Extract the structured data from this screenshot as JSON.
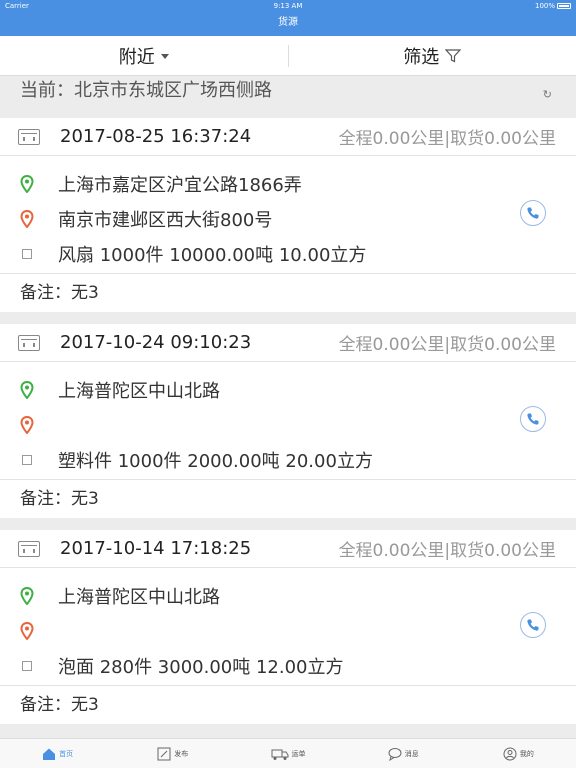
{
  "status": {
    "carrier": "Carrier",
    "time": "9:13 AM",
    "battery": "100%"
  },
  "nav": {
    "title": "货源"
  },
  "filter": {
    "nearby_label": "附近",
    "filter_label": "筛选"
  },
  "location": {
    "current": "当前：北京市东城区广场西侧路"
  },
  "cards": [
    {
      "date": "2017-08-25 16:37:24",
      "distance": "全程0.00公里|取货0.00公里",
      "from": "上海市嘉定区沪宜公路1866弄",
      "to": "南京市建邺区西大街800号",
      "goods": "风扇 1000件  10000.00吨  10.00立方",
      "note": "备注：无3"
    },
    {
      "date": "2017-10-24 09:10:23",
      "distance": "全程0.00公里|取货0.00公里",
      "from": "上海普陀区中山北路",
      "to": "",
      "goods": "塑料件 1000件  2000.00吨  20.00立方",
      "note": "备注：无3"
    },
    {
      "date": "2017-10-14 17:18:25",
      "distance": "全程0.00公里|取货0.00公里",
      "from": "上海普陀区中山北路",
      "to": "",
      "goods": "泡面 280件  3000.00吨  12.00立方",
      "note": "备注：无3"
    }
  ],
  "tabs": [
    {
      "label": "首页",
      "icon": "home-icon"
    },
    {
      "label": "发布",
      "icon": "edit-icon"
    },
    {
      "label": "运单",
      "icon": "truck-icon"
    },
    {
      "label": "消息",
      "icon": "chat-icon"
    },
    {
      "label": "我的",
      "icon": "user-icon"
    }
  ],
  "colors": {
    "accent": "#4a90e2",
    "pin_green": "#3cb043",
    "pin_red": "#e8643c"
  }
}
